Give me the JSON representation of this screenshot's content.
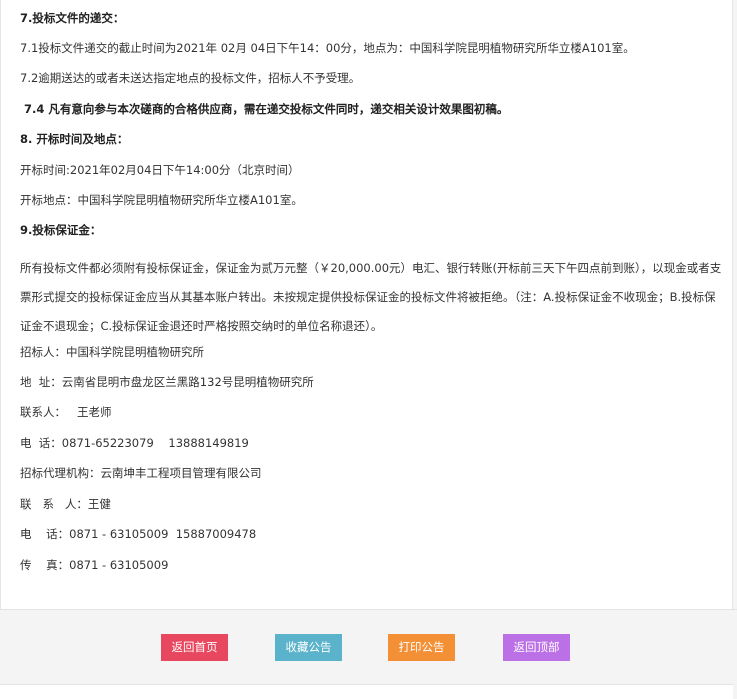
{
  "section7": {
    "heading": "7.投标文件的递交：",
    "item1": "7.1投标文件递交的截止时间为2021年 02月 04日下午14：00分，地点为：中国科学院昆明植物研究所华立楼A101室。",
    "item2": "7.2逾期送达的或者未送达指定地点的投标文件，招标人不予受理。",
    "item4": " 7.4 凡有意向参与本次磋商的合格供应商，需在递交投标文件同时，递交相关设计效果图初稿。"
  },
  "section8": {
    "heading": "8. 开标时间及地点：",
    "time": "开标时间:2021年02月04日下午14:00分（北京时间）",
    "place": "开标地点：中国科学院昆明植物研究所华立楼A101室。"
  },
  "section9": {
    "heading": "9.投标保证金：",
    "body": "所有投标文件都必须附有投标保证金，保证金为贰万元整（￥20,000.00元）电汇、银行转账(开标前三天下午四点前到账），以现金或者支票形式提交的投标保证金应当从其基本账户转出。未按规定提供投标保证金的投标文件将被拒绝。（注：A.投标保证金不收现金；B.投标保证金不退现金；C.投标保证金退还时严格按照交纳时的单位名称退还）。"
  },
  "contacts": {
    "tenderer": "招标人：中国科学院昆明植物研究所",
    "address": "地  址：云南省昆明市盘龙区兰黑路132号昆明植物研究所",
    "contact": "联系人：   王老师",
    "phone": "电  话：0871-65223079    13888149819",
    "agency": "招标代理机构：云南坤丰工程项目管理有限公司",
    "agency_contact": "联   系   人：王健",
    "agency_phone": "电    话：0871 - 63105009  15887009478",
    "agency_fax": "传    真：0871 - 63105009"
  },
  "footer": {
    "buttons": [
      {
        "label": "返回首页",
        "color": "#e8485f"
      },
      {
        "label": "收藏公告",
        "color": "#5bb3cb"
      },
      {
        "label": "打印公告",
        "color": "#f39036"
      },
      {
        "label": "返回顶部",
        "color": "#bb70e6"
      }
    ]
  }
}
